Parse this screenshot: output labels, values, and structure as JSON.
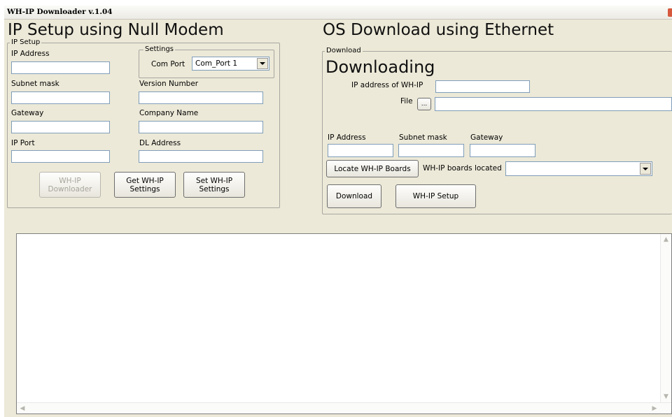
{
  "window": {
    "title": "WH-IP Downloader v.1.04"
  },
  "left": {
    "heading": "IP Setup using Null Modem",
    "group_label": "IP Setup",
    "ip_address_label": "IP Address",
    "subnet_mask_label": "Subnet mask",
    "gateway_label": "Gateway",
    "ip_port_label": "IP Port",
    "ip_address_value": "",
    "subnet_mask_value": "",
    "gateway_value": "",
    "ip_port_value": "",
    "settings": {
      "group_label": "Settings",
      "com_port_label": "Com Port",
      "com_port_value": "Com_Port 1"
    },
    "version_number_label": "Version Number",
    "company_name_label": "Company Name",
    "dl_address_label": "DL Address",
    "version_number_value": "",
    "company_name_value": "",
    "dl_address_value": "",
    "buttons": {
      "downloader": "WH-IP\nDownloader",
      "get_settings": "Get WH-IP\nSettings",
      "set_settings": "Set WH-IP\nSettings"
    }
  },
  "right": {
    "heading": "OS Download using Ethernet",
    "group_label": "Download",
    "status": "Downloading",
    "wh_ip_address_label": "IP address of WH-IP",
    "wh_ip_address_value": "",
    "file_label": "File",
    "browse_label": "...",
    "file_value": "",
    "ip_address_label": "IP Address",
    "subnet_mask_label": "Subnet mask",
    "gateway_label": "Gateway",
    "ip_address_value": "",
    "subnet_mask_value": "",
    "gateway_value": "",
    "locate_button": "Locate WH-IP Boards",
    "boards_located_label": "WH-IP boards located",
    "boards_located_value": "",
    "download_button": "Download",
    "setup_button": "WH-IP Setup"
  },
  "log": {
    "text": ""
  },
  "colors": {
    "window_bg": "#ece9d8",
    "field_border": "#7f9db9",
    "close_button": "#d6593e"
  }
}
